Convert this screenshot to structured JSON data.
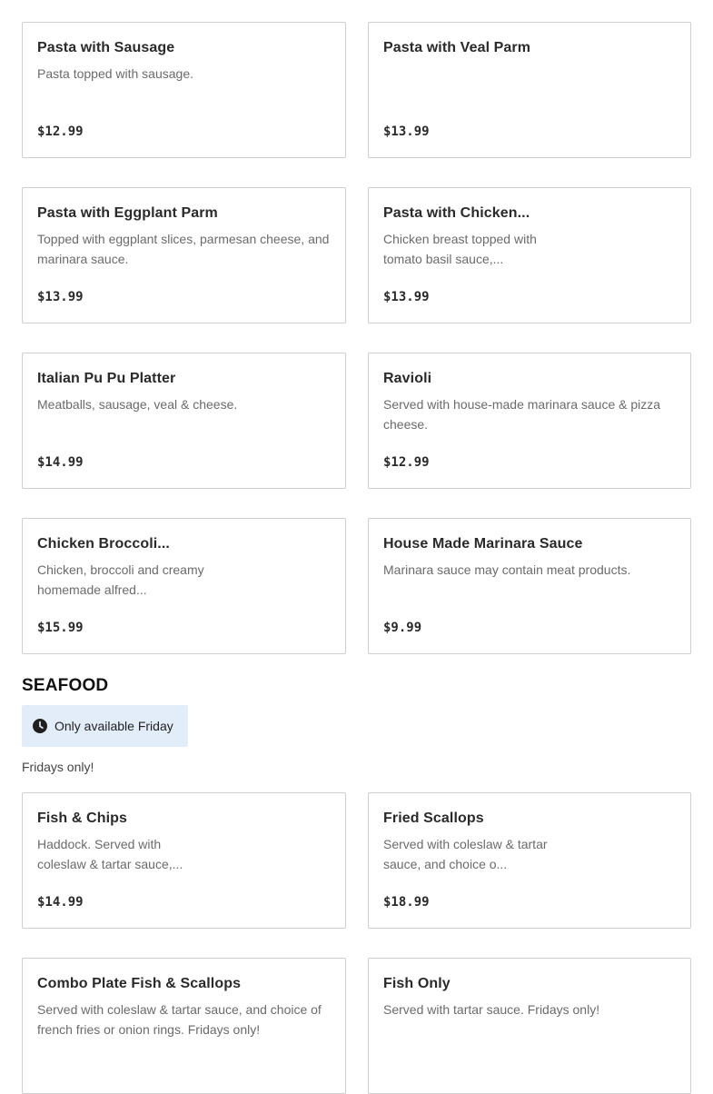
{
  "pasta_items": [
    {
      "name": "Pasta with Sausage",
      "description": "Pasta topped with sausage.",
      "price": "$12.99"
    },
    {
      "name": "Pasta with Veal Parm",
      "description": "",
      "price": "$13.99"
    },
    {
      "name": "Pasta with Eggplant Parm",
      "description": "Topped with eggplant slices, parmesan cheese, and marinara sauce.",
      "price": "$13.99"
    },
    {
      "name": "Pasta with Chicken...",
      "description": "Chicken breast topped with tomato basil sauce,...",
      "price": "$13.99"
    },
    {
      "name": "Italian Pu Pu Platter",
      "description": "Meatballs, sausage, veal & cheese.",
      "price": "$14.99"
    },
    {
      "name": "Ravioli",
      "description": "Served with house-made marinara sauce & pizza cheese.",
      "price": "$12.99"
    },
    {
      "name": "Chicken Broccoli...",
      "description": "Chicken, broccoli and creamy homemade alfred...",
      "price": "$15.99"
    },
    {
      "name": "House Made Marinara Sauce",
      "description": "Marinara sauce may contain meat products.",
      "price": "$9.99"
    }
  ],
  "seafood": {
    "title": "SEAFOOD",
    "availability": "Only available Friday",
    "availability_icon": "clock-icon",
    "note": "Fridays only!",
    "items": [
      {
        "name": "Fish & Chips",
        "description": "Haddock. Served with coleslaw & tartar sauce,...",
        "price": "$14.99"
      },
      {
        "name": "Fried Scallops",
        "description": "Served with coleslaw & tartar sauce, and choice o...",
        "price": "$18.99"
      },
      {
        "name": "Combo Plate Fish & Scallops",
        "description": "Served with coleslaw & tartar sauce, and choice of french fries or onion rings. Fridays only!",
        "price": ""
      },
      {
        "name": "Fish Only",
        "description": "Served with tartar sauce. Fridays only!",
        "price": ""
      }
    ]
  },
  "colors": {
    "card_border": "#cfcfcf",
    "availability_bg": "#e3edfa",
    "text_primary": "#2a2a2a",
    "text_secondary": "#6b6b6b"
  }
}
